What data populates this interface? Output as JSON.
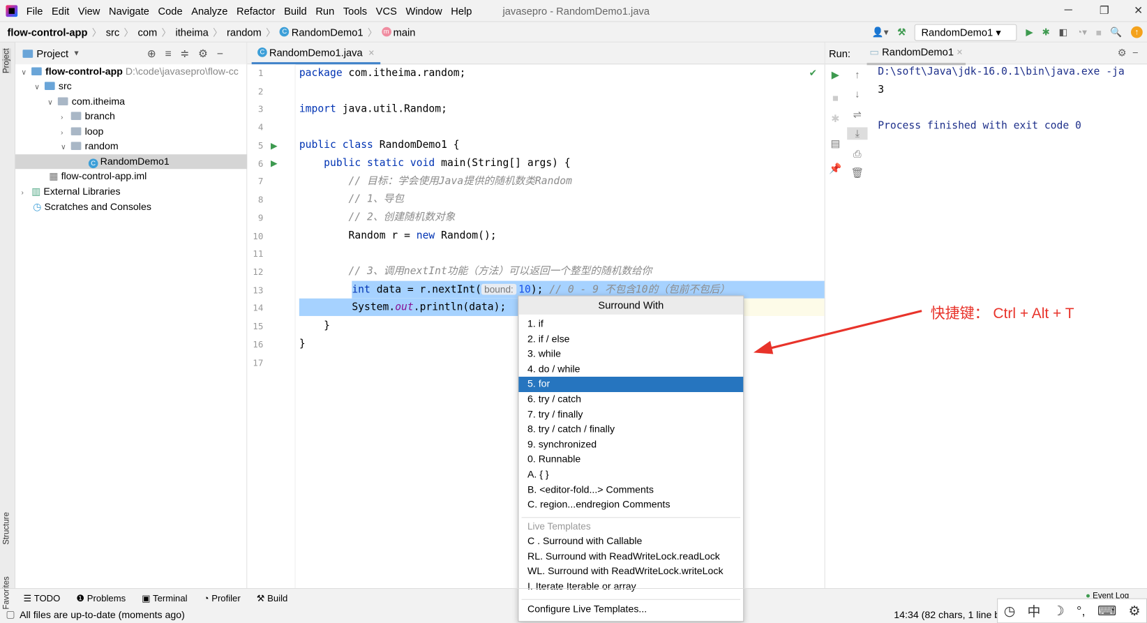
{
  "menubar": {
    "items": [
      "File",
      "Edit",
      "View",
      "Navigate",
      "Code",
      "Analyze",
      "Refactor",
      "Build",
      "Run",
      "Tools",
      "VCS",
      "Window",
      "Help"
    ],
    "window_title": "javasepro - RandomDemo1.java"
  },
  "breadcrumb": [
    "flow-control-app",
    "src",
    "com",
    "itheima",
    "random",
    "RandomDemo1",
    "main"
  ],
  "toolbar": {
    "run_config": "RandomDemo1"
  },
  "sidebar_strip": {
    "project": "Project",
    "structure": "Structure",
    "favorites": "Favorites"
  },
  "project": {
    "title": "Project",
    "tree": [
      {
        "label": "flow-control-app",
        "path": "D:\\code\\javasepro\\flow-cc",
        "depth": 0,
        "expanded": true
      },
      {
        "label": "src",
        "depth": 1,
        "expanded": true
      },
      {
        "label": "com.itheima",
        "depth": 2,
        "expanded": true
      },
      {
        "label": "branch",
        "depth": 3,
        "expanded": false
      },
      {
        "label": "loop",
        "depth": 3,
        "expanded": false
      },
      {
        "label": "random",
        "depth": 3,
        "expanded": true
      },
      {
        "label": "RandomDemo1",
        "depth": 4,
        "selected": true
      },
      {
        "label": "flow-control-app.iml",
        "depth": 2
      },
      {
        "label": "External Libraries",
        "depth": 0,
        "expanded": false
      },
      {
        "label": "Scratches and Consoles",
        "depth": 0
      }
    ]
  },
  "editor": {
    "tab": "RandomDemo1.java",
    "line_numbers": [
      "1",
      "2",
      "3",
      "4",
      "5",
      "6",
      "7",
      "8",
      "9",
      "10",
      "11",
      "12",
      "13",
      "14",
      "15",
      "16",
      "17"
    ],
    "lines": {
      "l1a": "package",
      "l1b": " com.itheima.random;",
      "l3a": "import",
      "l3b": " java.util.Random;",
      "l5a": "public class",
      "l5b": " RandomDemo1 {",
      "l6a": "    public static void",
      "l6b": " main(String[] args) {",
      "l7": "        // 目标：学会使用Java提供的随机数类Random",
      "l8": "        // 1、导包",
      "l9": "        // 2、创建随机数对象",
      "l10a": "        Random r = ",
      "l10b": "new",
      "l10c": " Random();",
      "l12": "        // 3、调用nextInt功能（方法）可以返回一个整型的随机数给你",
      "l13a": "int",
      "l13b": " data = r.nextInt(",
      "l13hint": "bound:",
      "l13num": "10",
      "l13c": "); ",
      "l13cm": "// 0 - 9 不包含10的（包前不包后）",
      "l14a": "System.",
      "l14b": "out",
      "l14c": ".println(data);",
      "l15": "    }",
      "l16": "}"
    }
  },
  "run": {
    "label": "Run:",
    "tab": "RandomDemo1",
    "output": [
      "D:\\soft\\Java\\jdk-16.0.1\\bin\\java.exe -ja",
      "3",
      "",
      "Process finished with exit code 0"
    ]
  },
  "popup": {
    "title": "Surround With",
    "items": [
      "1. if",
      "2. if / else",
      "3. while",
      "4. do / while",
      "5. for",
      "6. try / catch",
      "7. try / finally",
      "8. try / catch / finally",
      "9. synchronized",
      "0. Runnable",
      "A. { }",
      "B. <editor-fold...> Comments",
      "C. region...endregion Comments"
    ],
    "selected_index": 4,
    "live_templates_label": "Live Templates",
    "live_templates": [
      "C . Surround with Callable",
      "RL. Surround with ReadWriteLock.readLock",
      "WL. Surround with ReadWriteLock.writeLock",
      "I. Iterate Iterable or array"
    ],
    "configure": "Configure Live Templates..."
  },
  "annotation": {
    "text": "快捷键：  Ctrl + Alt + T",
    "color": "#e8332a"
  },
  "bottom_tools": [
    "TODO",
    "Problems",
    "Terminal",
    "Profiler",
    "Build"
  ],
  "event_log": "Event Log",
  "status": {
    "message": "All files are up-to-date (moments ago)",
    "position": "14:34 (82 chars, 1 line b"
  },
  "ime": [
    "中",
    "☽",
    "°,",
    "⌨",
    "⚙"
  ]
}
